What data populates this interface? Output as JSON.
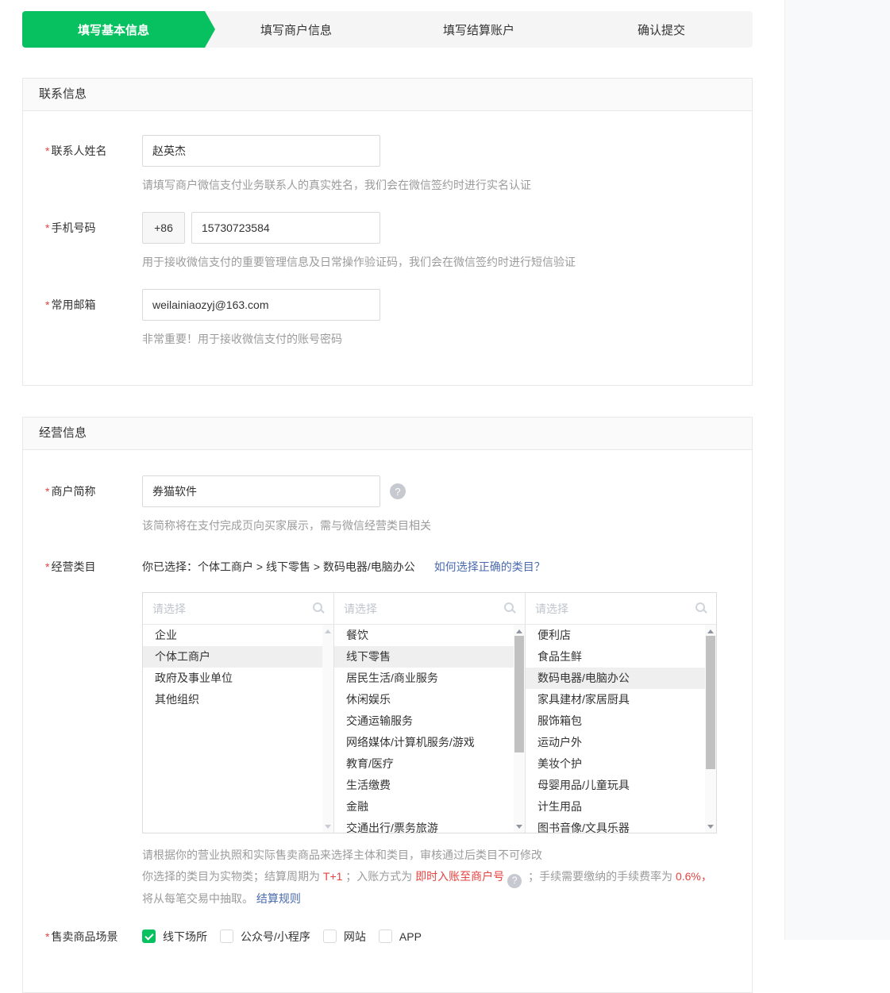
{
  "colors": {
    "green": "#07c160",
    "red": "#e64340",
    "link_blue": "#4a6aae"
  },
  "steps": [
    {
      "label": "填写基本信息",
      "active": true
    },
    {
      "label": "填写商户信息",
      "active": false
    },
    {
      "label": "填写结算账户",
      "active": false
    },
    {
      "label": "确认提交",
      "active": false
    }
  ],
  "contact": {
    "title": "联系信息",
    "name": {
      "label": "联系人姓名",
      "value": "赵英杰",
      "hint": "请填写商户微信支付业务联系人的真实姓名，我们会在微信签约时进行实名认证"
    },
    "phone": {
      "label": "手机号码",
      "prefix": "+86",
      "value": "15730723584",
      "hint": "用于接收微信支付的重要管理信息及日常操作验证码，我们会在微信签约时进行短信验证"
    },
    "email": {
      "label": "常用邮箱",
      "value": "weilainiaozyj@163.com",
      "hint": "非常重要！用于接收微信支付的账号密码"
    }
  },
  "business": {
    "title": "经营信息",
    "shortname": {
      "label": "商户简称",
      "value": "券猫软件",
      "help_icon": "question-mark",
      "hint": "该简称将在支付完成页向买家展示，需与微信经营类目相关"
    },
    "category": {
      "label": "经营类目",
      "selected_prefix": "你已选择：",
      "selected_path": "个体工商户 > 线下零售 > 数码电器/电脑办公",
      "help_link": "如何选择正确的类目？",
      "search_placeholder": "请选择",
      "columns": [
        {
          "selected": "个体工商户",
          "items": [
            "企业",
            "个体工商户",
            "政府及事业单位",
            "其他组织"
          ]
        },
        {
          "selected": "线下零售",
          "items": [
            "餐饮",
            "线下零售",
            "居民生活/商业服务",
            "休闲娱乐",
            "交通运输服务",
            "网络媒体/计算机服务/游戏",
            "教育/医疗",
            "生活缴费",
            "金融",
            "交通出行/票务旅游"
          ]
        },
        {
          "selected": "数码电器/电脑办公",
          "items": [
            "便利店",
            "食品生鲜",
            "数码电器/电脑办公",
            "家具建材/家居厨具",
            "服饰箱包",
            "运动户外",
            "美妆个护",
            "母婴用品/儿童玩具",
            "计生用品",
            "图书音像/文具乐器"
          ]
        }
      ],
      "note1": "请根据你的营业执照和实际售卖商品来选择主体和类目，审核通过后类目不可修改",
      "note2": {
        "p1": "你选择的类目为实物类；结算周期为 ",
        "r1": "T+1",
        "p2": " ；入账方式为 ",
        "r2": "即时入账至商户号",
        "p3": " ；手续需要缴纳的手续费率为 ",
        "r3": "0.6%，",
        "p5": "将从每笔交易中抽取。 ",
        "link": "结算规则"
      }
    },
    "scene": {
      "label": "售卖商品场景",
      "options": [
        {
          "label": "线下场所",
          "checked": true
        },
        {
          "label": "公众号/小程序",
          "checked": false
        },
        {
          "label": "网站",
          "checked": false
        },
        {
          "label": "APP",
          "checked": false
        }
      ]
    }
  }
}
